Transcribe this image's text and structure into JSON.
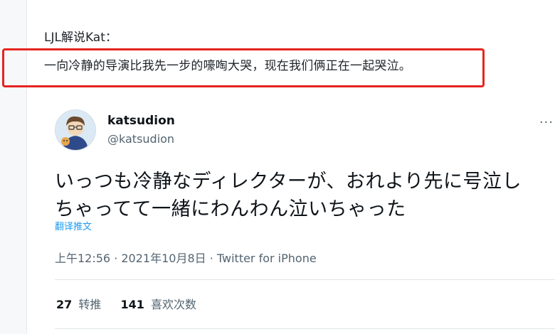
{
  "post": {
    "caption": "LJL解说Kat：",
    "quote": "一向冷静的导演比我先一步的嚎啕大哭，现在我们俩正在一起哭泣。"
  },
  "tweet": {
    "display_name": "katsudion",
    "handle": "@katsudion",
    "text_line1": "いっつも冷静なディレクターが、おれより先に号泣し",
    "text_line2": "ちゃってて一緒にわんわん泣いちゃった",
    "translate_label": "翻译推文",
    "meta": "上午12:56 · 2021年10月8日 · Twitter for iPhone",
    "retweets_count": "27",
    "retweets_label": "转推",
    "likes_count": "141",
    "likes_label": "喜欢次数"
  },
  "colors": {
    "highlight_border": "#e52420",
    "link": "#1d9bf0",
    "secondary_text": "#536471"
  },
  "icons": {
    "more": "more-options-icon",
    "avatar": "avatar-image"
  }
}
